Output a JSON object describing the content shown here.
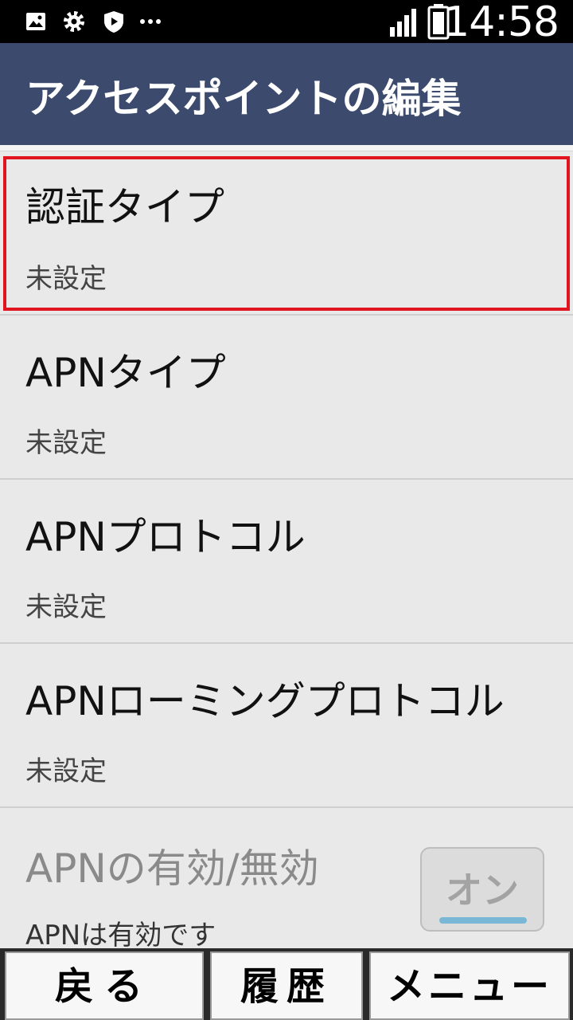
{
  "status_bar": {
    "icons": [
      "image-icon",
      "gear-icon",
      "play-shield-icon",
      "more-dots-icon"
    ],
    "time": "14:58"
  },
  "header": {
    "title": "アクセスポイントの編集"
  },
  "settings": [
    {
      "title": "認証タイプ",
      "value": "未設定",
      "selected": true
    },
    {
      "title": "APNタイプ",
      "value": "未設定"
    },
    {
      "title": "APNプロトコル",
      "value": "未設定"
    },
    {
      "title": "APNローミングプロトコル",
      "value": "未設定"
    },
    {
      "title": "APNの有効/無効",
      "value": "APNは有効です",
      "toggle": "オン",
      "disabled": true
    }
  ],
  "softkeys": {
    "back": "戻る",
    "history": "履歴",
    "menu": "メニュー"
  },
  "colors": {
    "header_bg": "#3c4b6d",
    "selection": "#e0151f",
    "toggle_accent": "#7ab7d6"
  }
}
